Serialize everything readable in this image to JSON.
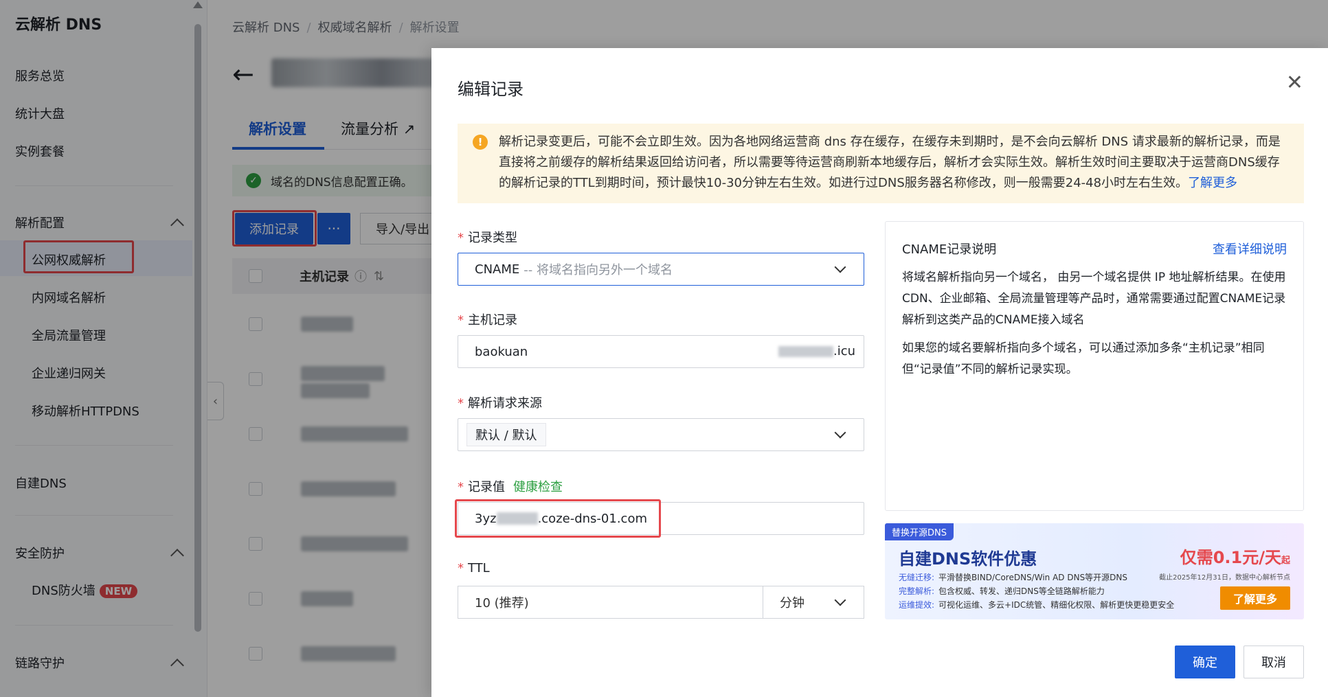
{
  "sidebar": {
    "brand": "云解析 DNS",
    "overview": "服务总览",
    "dashboard": "统计大盘",
    "instances": "实例套餐",
    "group_resolve": "解析配置",
    "sub_public": "公网权威解析",
    "sub_private": "内网域名解析",
    "sub_gtm": "全局流量管理",
    "sub_recursive": "企业递归网关",
    "sub_httpdns": "移动解析HTTPDNS",
    "self_dns": "自建DNS",
    "group_security": "安全防护",
    "sub_firewall": "DNS防火墙",
    "new_badge": "NEW",
    "group_link": "链路守护"
  },
  "breadcrumb": {
    "root": "云解析 DNS",
    "level2": "权威域名解析",
    "current": "解析设置"
  },
  "page": {
    "title_suffix": ".ic",
    "tab_settings": "解析设置",
    "tab_traffic": "流量分析",
    "success_msg": "域名的DNS信息配置正确。",
    "add_record": "添加记录",
    "more": "···",
    "import_export": "导入/导出",
    "col_host": "主机记录"
  },
  "modal": {
    "title": "编辑记录",
    "notice": "解析记录变更后，可能不会立即生效。因为各地网络运营商 dns 存在缓存，在缓存未到期时，是不会向云解析 DNS 请求最新的解析记录，而是直接将之前缓存的解析结果返回给访问者，所以需要等待运营商刷新本地缓存后，解析才会实际生效。解析生效时间主要取决于运营商DNS缓存的解析记录的TTL到期时间，预计最快10-30分钟左右生效。如进行过DNS服务器名称修改，则一般需要24-48小时左右生效。",
    "notice_link": "了解更多",
    "label_type": "记录类型",
    "type_value": "CNAME",
    "type_desc": "-- 将域名指向另外一个域名",
    "label_host": "主机记录",
    "host_value": "baokuan",
    "host_suffix": ".icu",
    "label_source": "解析请求来源",
    "source_value": "默认 / 默认",
    "label_value": "记录值",
    "health_check": "健康检查",
    "record_prefix": "3yz",
    "record_suffix": ".coze-dns-01.com",
    "label_ttl": "TTL",
    "ttl_value": "10 (推荐)",
    "ttl_unit": "分钟",
    "ok": "确定",
    "cancel": "取消"
  },
  "info": {
    "title": "CNAME记录说明",
    "link": "查看详细说明",
    "p1": "将域名解析指向另一个域名， 由另一个域名提供 IP 地址解析结果。在使用CDN、企业邮箱、全局流量管理等产品时，通常需要通过配置CNAME记录解析到这类产品的CNAME接入域名",
    "p2": "如果您的域名要解析指向多个域名，可以通过添加多条“主机记录”相同但“记录值”不同的解析记录实现。"
  },
  "banner": {
    "tag": "替换开源DNS",
    "title": "自建DNS软件优惠",
    "price": "仅需0.1元/天",
    "price_suffix": "起",
    "note": "截止2025年12月31日，数据中心解析节点",
    "l1_key": "无缝迁移:",
    "l1": "平滑替换BIND/CoreDNS/Win AD DNS等开源DNS",
    "l2_key": "完整解析:",
    "l2": "包含权威、转发、递归DNS等全链路解析能力",
    "l3_key": "运维提效:",
    "l3": "可视化运维、多云+IDC统管、精细化权限、解析更快更稳更安全",
    "button": "了解更多"
  }
}
